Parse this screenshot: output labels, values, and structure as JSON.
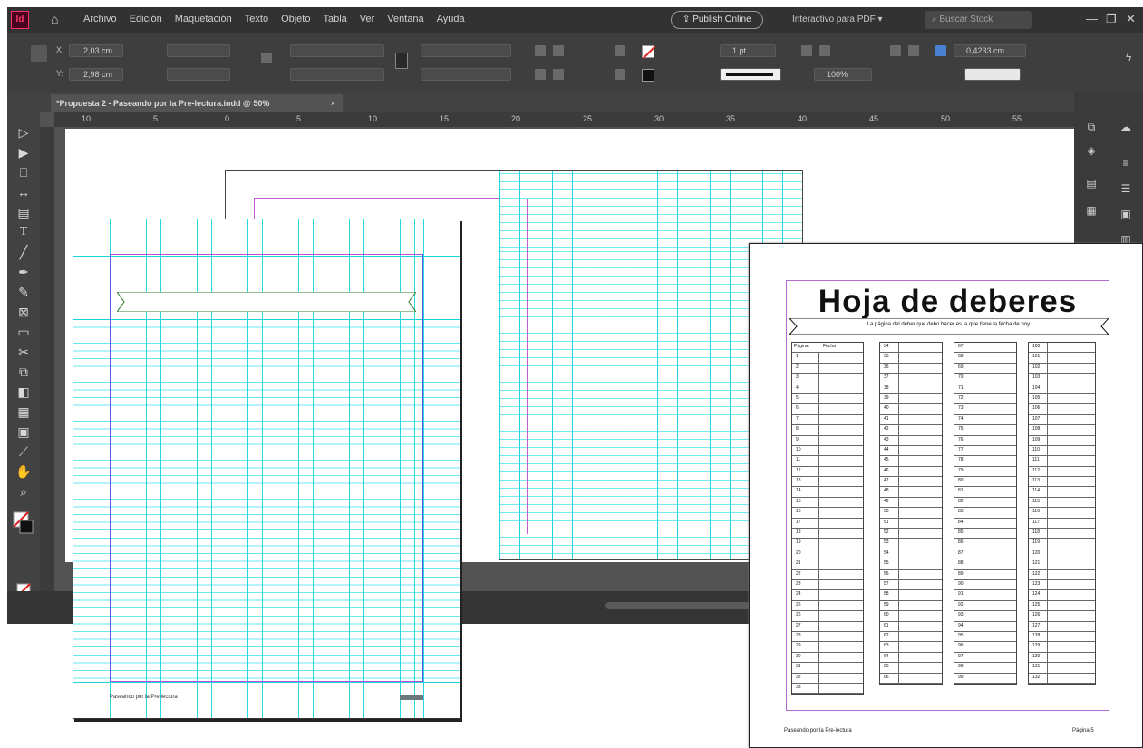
{
  "app": {
    "logo": "Id",
    "menus": [
      "Archivo",
      "Edición",
      "Maquetación",
      "Texto",
      "Objeto",
      "Tabla",
      "Ver",
      "Ventana",
      "Ayuda"
    ],
    "publish_label": "Publish Online",
    "workspace_label": "Interactivo para PDF",
    "search_placeholder": "Buscar Stock",
    "accent_color": "#ff3366"
  },
  "control_bar": {
    "x_value": "2,03 cm",
    "y_value": "2,98 cm",
    "stroke_weight": "1 pt",
    "zoom_percent": "100%",
    "gutter_value": "0,4233 cm"
  },
  "document": {
    "tab_title": "*Propuesta 2 - Paseando por la Pre-lectura.indd @ 50%",
    "tab_close": "×",
    "ruler_h_ticks": [
      "10",
      "5",
      "0",
      "5",
      "10",
      "15",
      "20",
      "25",
      "30",
      "35",
      "40",
      "45",
      "50",
      "55"
    ]
  },
  "left_page": {
    "footer_text": "Paseando por la Pre-lectura"
  },
  "preview": {
    "title": "Hoja de deberes",
    "subtitle": "La página del deber que debo hacer es la que tiene la fecha de hoy.",
    "col1_header_page": "Página",
    "col1_header_date": "Fecha",
    "footer_left": "Paseando por la Pre-lectura",
    "footer_right": "Página 5",
    "table1_numbers": [
      "1",
      "2",
      "3",
      "4",
      "5",
      "6",
      "7",
      "8",
      "9",
      "10",
      "11",
      "12",
      "13",
      "14",
      "15",
      "16",
      "17",
      "18",
      "19",
      "20",
      "21",
      "22",
      "23",
      "24",
      "25",
      "26",
      "27",
      "28",
      "29",
      "30",
      "31",
      "32",
      "33"
    ],
    "table2_numbers": [
      "34",
      "35",
      "36",
      "37",
      "38",
      "39",
      "40",
      "41",
      "42",
      "43",
      "44",
      "45",
      "46",
      "47",
      "48",
      "49",
      "50",
      "51",
      "52",
      "53",
      "54",
      "55",
      "56",
      "57",
      "58",
      "59",
      "60",
      "61",
      "62",
      "63",
      "64",
      "65",
      "66"
    ],
    "table3_numbers": [
      "67",
      "68",
      "69",
      "70",
      "71",
      "72",
      "73",
      "74",
      "75",
      "76",
      "77",
      "78",
      "79",
      "80",
      "81",
      "82",
      "83",
      "84",
      "85",
      "86",
      "87",
      "88",
      "89",
      "90",
      "91",
      "92",
      "93",
      "94",
      "95",
      "96",
      "97",
      "98",
      "99"
    ],
    "table4_numbers": [
      "100",
      "101",
      "102",
      "103",
      "104",
      "105",
      "106",
      "107",
      "108",
      "109",
      "110",
      "111",
      "112",
      "113",
      "114",
      "115",
      "116",
      "117",
      "118",
      "119",
      "120",
      "121",
      "122",
      "123",
      "124",
      "125",
      "126",
      "127",
      "128",
      "129",
      "130",
      "131",
      "132"
    ]
  }
}
